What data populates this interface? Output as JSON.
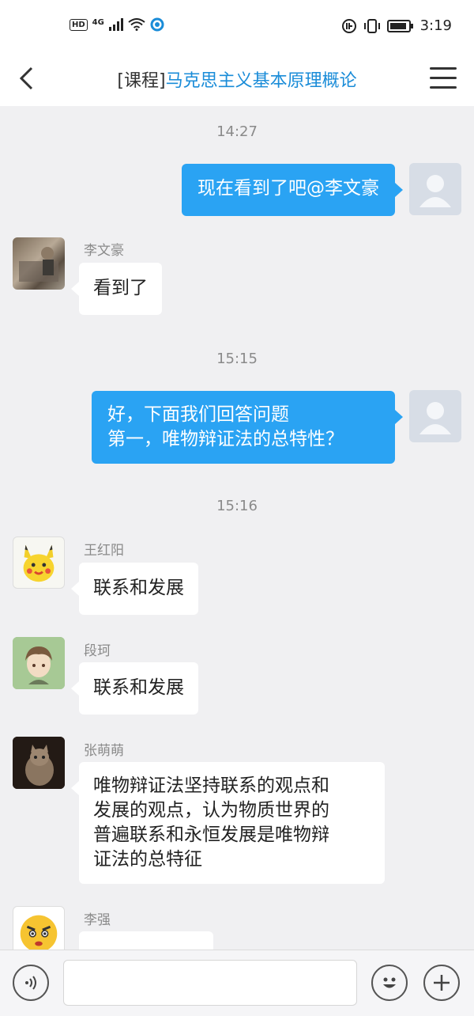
{
  "status_bar": {
    "network": "4G",
    "hd": "HD",
    "time": "3:19"
  },
  "header": {
    "title_prefix": "[课程]",
    "title_name": "马克思主义基本原理概论"
  },
  "messages": [
    {
      "type": "timestamp",
      "text": "14:27"
    },
    {
      "type": "outgoing",
      "text": "现在看到了吧@李文豪"
    },
    {
      "type": "incoming",
      "sender": "李文豪",
      "text": "看到了"
    },
    {
      "type": "timestamp",
      "text": "15:15"
    },
    {
      "type": "outgoing",
      "lines": [
        "好，下面我们回答问题",
        "第一，唯物辩证法的总特性？"
      ]
    },
    {
      "type": "timestamp",
      "text": "15:16"
    },
    {
      "type": "incoming",
      "sender": "王红阳",
      "text": "联系和发展"
    },
    {
      "type": "incoming",
      "sender": "段珂",
      "text": "联系和发展"
    },
    {
      "type": "incoming",
      "sender": "张萌萌",
      "lines": [
        "唯物辩证法坚持联系的观点和",
        "发展的观点，认为物质世界的",
        "普遍联系和永恒发展是唯物辩",
        "证法的总特征"
      ]
    },
    {
      "type": "incoming",
      "sender": "李强",
      "text": ""
    }
  ],
  "input": {
    "placeholder": ""
  },
  "colors": {
    "accent": "#2aa3f3",
    "title_blue": "#1a8cd8",
    "background": "#f0f0f2"
  }
}
